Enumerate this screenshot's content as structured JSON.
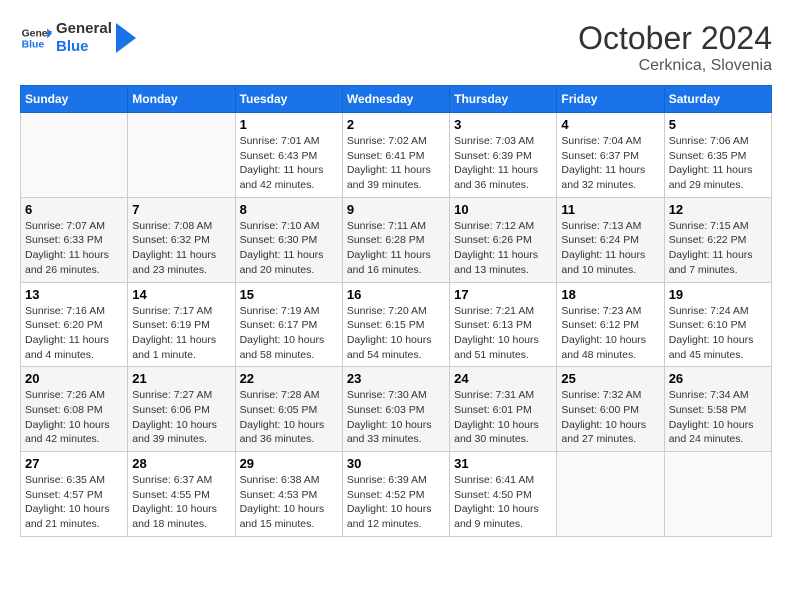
{
  "header": {
    "logo_general": "General",
    "logo_blue": "Blue",
    "month_title": "October 2024",
    "location": "Cerknica, Slovenia"
  },
  "days_of_week": [
    "Sunday",
    "Monday",
    "Tuesday",
    "Wednesday",
    "Thursday",
    "Friday",
    "Saturday"
  ],
  "weeks": [
    [
      {
        "day": "",
        "info": ""
      },
      {
        "day": "",
        "info": ""
      },
      {
        "day": "1",
        "sunrise": "Sunrise: 7:01 AM",
        "sunset": "Sunset: 6:43 PM",
        "daylight": "Daylight: 11 hours and 42 minutes."
      },
      {
        "day": "2",
        "sunrise": "Sunrise: 7:02 AM",
        "sunset": "Sunset: 6:41 PM",
        "daylight": "Daylight: 11 hours and 39 minutes."
      },
      {
        "day": "3",
        "sunrise": "Sunrise: 7:03 AM",
        "sunset": "Sunset: 6:39 PM",
        "daylight": "Daylight: 11 hours and 36 minutes."
      },
      {
        "day": "4",
        "sunrise": "Sunrise: 7:04 AM",
        "sunset": "Sunset: 6:37 PM",
        "daylight": "Daylight: 11 hours and 32 minutes."
      },
      {
        "day": "5",
        "sunrise": "Sunrise: 7:06 AM",
        "sunset": "Sunset: 6:35 PM",
        "daylight": "Daylight: 11 hours and 29 minutes."
      }
    ],
    [
      {
        "day": "6",
        "sunrise": "Sunrise: 7:07 AM",
        "sunset": "Sunset: 6:33 PM",
        "daylight": "Daylight: 11 hours and 26 minutes."
      },
      {
        "day": "7",
        "sunrise": "Sunrise: 7:08 AM",
        "sunset": "Sunset: 6:32 PM",
        "daylight": "Daylight: 11 hours and 23 minutes."
      },
      {
        "day": "8",
        "sunrise": "Sunrise: 7:10 AM",
        "sunset": "Sunset: 6:30 PM",
        "daylight": "Daylight: 11 hours and 20 minutes."
      },
      {
        "day": "9",
        "sunrise": "Sunrise: 7:11 AM",
        "sunset": "Sunset: 6:28 PM",
        "daylight": "Daylight: 11 hours and 16 minutes."
      },
      {
        "day": "10",
        "sunrise": "Sunrise: 7:12 AM",
        "sunset": "Sunset: 6:26 PM",
        "daylight": "Daylight: 11 hours and 13 minutes."
      },
      {
        "day": "11",
        "sunrise": "Sunrise: 7:13 AM",
        "sunset": "Sunset: 6:24 PM",
        "daylight": "Daylight: 11 hours and 10 minutes."
      },
      {
        "day": "12",
        "sunrise": "Sunrise: 7:15 AM",
        "sunset": "Sunset: 6:22 PM",
        "daylight": "Daylight: 11 hours and 7 minutes."
      }
    ],
    [
      {
        "day": "13",
        "sunrise": "Sunrise: 7:16 AM",
        "sunset": "Sunset: 6:20 PM",
        "daylight": "Daylight: 11 hours and 4 minutes."
      },
      {
        "day": "14",
        "sunrise": "Sunrise: 7:17 AM",
        "sunset": "Sunset: 6:19 PM",
        "daylight": "Daylight: 11 hours and 1 minute."
      },
      {
        "day": "15",
        "sunrise": "Sunrise: 7:19 AM",
        "sunset": "Sunset: 6:17 PM",
        "daylight": "Daylight: 10 hours and 58 minutes."
      },
      {
        "day": "16",
        "sunrise": "Sunrise: 7:20 AM",
        "sunset": "Sunset: 6:15 PM",
        "daylight": "Daylight: 10 hours and 54 minutes."
      },
      {
        "day": "17",
        "sunrise": "Sunrise: 7:21 AM",
        "sunset": "Sunset: 6:13 PM",
        "daylight": "Daylight: 10 hours and 51 minutes."
      },
      {
        "day": "18",
        "sunrise": "Sunrise: 7:23 AM",
        "sunset": "Sunset: 6:12 PM",
        "daylight": "Daylight: 10 hours and 48 minutes."
      },
      {
        "day": "19",
        "sunrise": "Sunrise: 7:24 AM",
        "sunset": "Sunset: 6:10 PM",
        "daylight": "Daylight: 10 hours and 45 minutes."
      }
    ],
    [
      {
        "day": "20",
        "sunrise": "Sunrise: 7:26 AM",
        "sunset": "Sunset: 6:08 PM",
        "daylight": "Daylight: 10 hours and 42 minutes."
      },
      {
        "day": "21",
        "sunrise": "Sunrise: 7:27 AM",
        "sunset": "Sunset: 6:06 PM",
        "daylight": "Daylight: 10 hours and 39 minutes."
      },
      {
        "day": "22",
        "sunrise": "Sunrise: 7:28 AM",
        "sunset": "Sunset: 6:05 PM",
        "daylight": "Daylight: 10 hours and 36 minutes."
      },
      {
        "day": "23",
        "sunrise": "Sunrise: 7:30 AM",
        "sunset": "Sunset: 6:03 PM",
        "daylight": "Daylight: 10 hours and 33 minutes."
      },
      {
        "day": "24",
        "sunrise": "Sunrise: 7:31 AM",
        "sunset": "Sunset: 6:01 PM",
        "daylight": "Daylight: 10 hours and 30 minutes."
      },
      {
        "day": "25",
        "sunrise": "Sunrise: 7:32 AM",
        "sunset": "Sunset: 6:00 PM",
        "daylight": "Daylight: 10 hours and 27 minutes."
      },
      {
        "day": "26",
        "sunrise": "Sunrise: 7:34 AM",
        "sunset": "Sunset: 5:58 PM",
        "daylight": "Daylight: 10 hours and 24 minutes."
      }
    ],
    [
      {
        "day": "27",
        "sunrise": "Sunrise: 6:35 AM",
        "sunset": "Sunset: 4:57 PM",
        "daylight": "Daylight: 10 hours and 21 minutes."
      },
      {
        "day": "28",
        "sunrise": "Sunrise: 6:37 AM",
        "sunset": "Sunset: 4:55 PM",
        "daylight": "Daylight: 10 hours and 18 minutes."
      },
      {
        "day": "29",
        "sunrise": "Sunrise: 6:38 AM",
        "sunset": "Sunset: 4:53 PM",
        "daylight": "Daylight: 10 hours and 15 minutes."
      },
      {
        "day": "30",
        "sunrise": "Sunrise: 6:39 AM",
        "sunset": "Sunset: 4:52 PM",
        "daylight": "Daylight: 10 hours and 12 minutes."
      },
      {
        "day": "31",
        "sunrise": "Sunrise: 6:41 AM",
        "sunset": "Sunset: 4:50 PM",
        "daylight": "Daylight: 10 hours and 9 minutes."
      },
      {
        "day": "",
        "info": ""
      },
      {
        "day": "",
        "info": ""
      }
    ]
  ]
}
